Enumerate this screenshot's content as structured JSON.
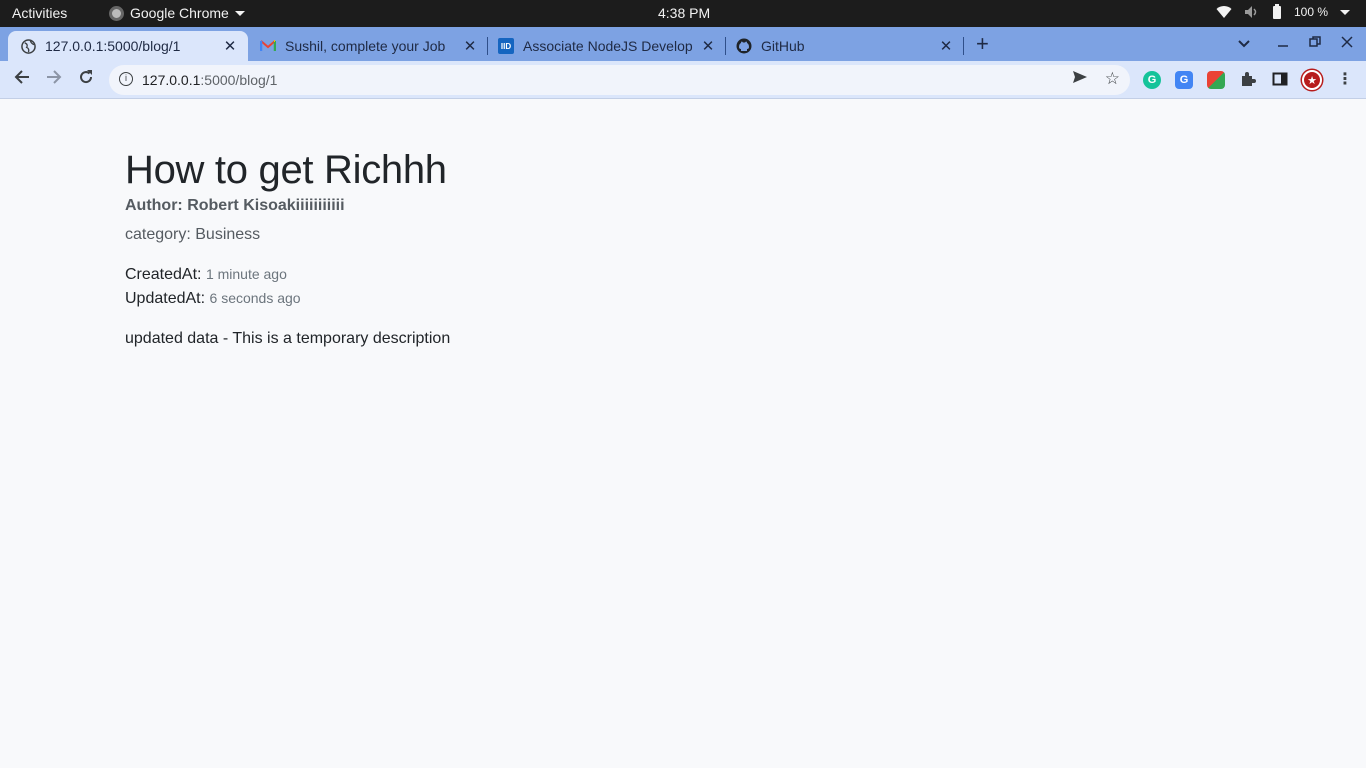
{
  "system_bar": {
    "activities": "Activities",
    "app_name": "Google Chrome",
    "clock": "4:38 PM",
    "battery": "100 %"
  },
  "tabs": [
    {
      "title": "127.0.0.1:5000/blog/1",
      "icon": "globe-icon",
      "active": true
    },
    {
      "title": "Sushil, complete your Job",
      "icon": "gmail-icon",
      "active": false
    },
    {
      "title": "Associate NodeJS Develop",
      "icon": "iide-icon",
      "active": false
    },
    {
      "title": "GitHub",
      "icon": "github-icon",
      "active": false
    }
  ],
  "address_bar": {
    "host": "127.0.0.1",
    "path": ":5000/blog/1"
  },
  "post": {
    "title": "How to get Richhh",
    "author": "Author: Robert Kisoakiiiiiiiiiii",
    "category": "category: Business",
    "created_label": "CreatedAt:",
    "created_value": "1 minute ago",
    "updated_label": "UpdatedAt:",
    "updated_value": "6 seconds ago",
    "description": "updated data - This is a temporary description"
  },
  "colors": {
    "tab_strip": "#7da2e3",
    "toolbar": "#dbe6fb",
    "page_background": "#f8f9fb",
    "text": "#212529"
  }
}
